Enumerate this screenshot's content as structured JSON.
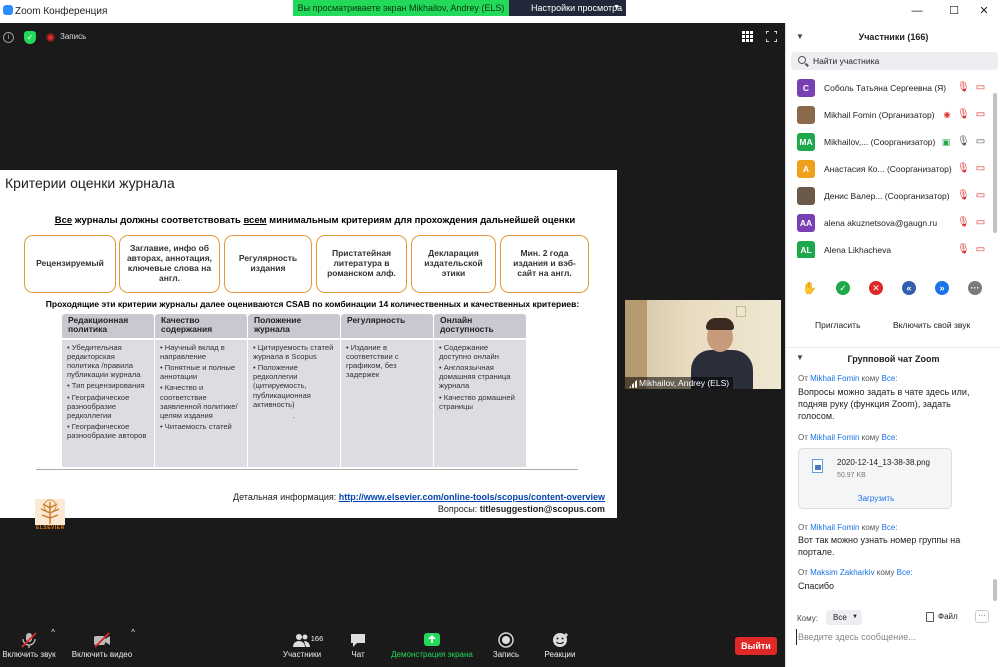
{
  "window": {
    "title": "Zoom Конференция",
    "minimize": "—",
    "maximize": "☐",
    "close": "✕"
  },
  "share_banner": {
    "text": "Вы просматриваете экран Mikhailov, Andrey (ELS)",
    "view_options": "Настройки просмотра"
  },
  "meeting_bar": {
    "info": "i",
    "shield": "✓",
    "recording_label": "Запись"
  },
  "slide": {
    "title": "Критерии оценки журнала",
    "subtitle_all": "Все",
    "subtitle_part1": " журналы должны соответствовать ",
    "subtitle_every": "всем",
    "subtitle_part2": " минимальным критериям для прохождения дальнейшей оценки",
    "criteria": [
      "Рецензируемый",
      "Заглавие, инфо об авторах, аннотация, ключевые слова на англ.",
      "Регулярность издания",
      "Пристатейная литература в романском алф.",
      "Декларация издательской этики",
      "Мин. 2 года издания и вэб-сайт на англ."
    ],
    "note": "Проходящие эти критерии журналы далее оцениваются CSAB по комбинации 14 количественных и качественных критериев:",
    "columns": [
      {
        "header": "Редакционная политика",
        "items": [
          "• Убедительная редакторская политика /правила публикации журнала",
          "• Тип рецензирования",
          "• Географическое разнообразие редколлегии",
          "• Географическое разнообразие авторов"
        ]
      },
      {
        "header": "Качество содержания",
        "items": [
          "• Научный вклад в направление",
          "• Понятные и полные аннотации",
          "• Качество и соответствие заявленной политике/целям издания",
          "• Читаемость статей"
        ]
      },
      {
        "header": "Положение журнала",
        "items": [
          "• Цитируемость статей журнала в Scopus",
          "• Положение редколлегии (цитируемость, публикационная активность)",
          "."
        ]
      },
      {
        "header": "Регулярность",
        "items": [
          "• Издание в соответствии с графиком, без задержек"
        ]
      },
      {
        "header": "Онлайн доступность",
        "items": [
          "• Содержание доступно онлайн",
          "• Англоязычная домашняя страница журнала",
          "• Качество домашней страницы"
        ]
      }
    ],
    "logo_text": "ELSEVIER",
    "more_info_label": "Детальная информация: ",
    "more_info_url": "http://www.elsevier.com/online-tools/scopus/content-overview",
    "questions_label": "Вопросы: ",
    "questions_email": "titlesuggestion@scopus.com"
  },
  "video": {
    "name": "Mikhailov, Andrey (ELS)"
  },
  "toolbar": {
    "unmute": "Включить звук",
    "start_video": "Включить видео",
    "participants": "Участники",
    "participants_count": "166",
    "chat": "Чат",
    "share_screen": "Демонстрация экрана",
    "record": "Запись",
    "reactions": "Реакции",
    "leave": "Выйти"
  },
  "participants_panel": {
    "title": "Участники (166)",
    "search_placeholder": "Найти участника",
    "participants": [
      {
        "initials": "C",
        "color": "#7b3fb5",
        "name": "Соболь Татьяна Сергеевна (Я)"
      },
      {
        "initials": "",
        "color": "#8a6a4a",
        "name": "Mikhail Fomin (Организатор)"
      },
      {
        "initials": "MA",
        "color": "#1ea84c",
        "name": "Mikhailov,...  (Соорганизатор)"
      },
      {
        "initials": "A",
        "color": "#f0a01a",
        "name": "Анастасия Ко...  (Соорганизатор)"
      },
      {
        "initials": "",
        "color": "#6b5a4a",
        "name": "Денис Валер...  (Соорганизатор)"
      },
      {
        "initials": "AA",
        "color": "#7b3fb5",
        "name": "alena akuznetsova@gaugn.ru"
      },
      {
        "initials": "AL",
        "color": "#1ea84c",
        "name": "Alena Likhacheva"
      }
    ],
    "invite": "Пригласить",
    "unmute_me": "Включить свой звук"
  },
  "chat_panel": {
    "title": "Групповой чат Zoom",
    "from_word": "От ",
    "to_word": " кому ",
    "messages": [
      {
        "from": "Mikhail Fomin",
        "to": "Все:",
        "text": "Вопросы можно задать в чате здесь или, подняв руку (функция Zoom), задать голосом."
      },
      {
        "from": "Mikhail Fomin",
        "to": "Все:",
        "text": ""
      },
      {
        "from": "Mikhail Fomin",
        "to": "Все:",
        "text": "Вот так можно узнать номер группы на портале."
      },
      {
        "from": "Maksim Zakharkiv",
        "to": "Все:",
        "text": "Спасибо"
      }
    ],
    "file": {
      "name": "2020-12-14_13-38-38.png",
      "size": "50.97 KB",
      "download": "Загрузить"
    },
    "to_label": "Кому:",
    "to_value": "Все",
    "file_button": "Файл",
    "more": "···",
    "input_placeholder": "Введите здесь сообщение..."
  },
  "colors": {
    "accent_blue": "#1a73e8",
    "banner_green": "#23d959",
    "leave_red": "#e02828",
    "slide_border_orange": "#e09a3c"
  }
}
